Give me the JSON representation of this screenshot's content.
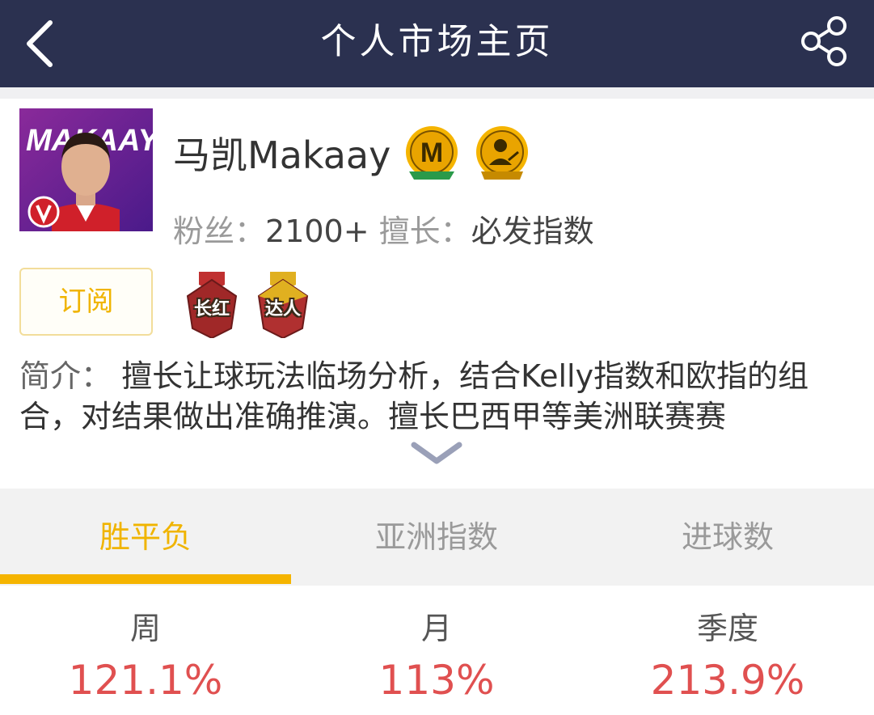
{
  "header": {
    "title": "个人市场主页",
    "back_icon": "back-arrow-icon",
    "share_icon": "share-icon"
  },
  "profile": {
    "name": "马凯Makaay",
    "avatar_text": "MAKAAY",
    "fans_label": "粉丝：",
    "fans_value": "2100+",
    "expertise_label": "擅长：",
    "expertise_value": "必发指数",
    "subscribe_label": "订阅",
    "medals": [
      {
        "label": "长红",
        "color": "#b03030"
      },
      {
        "label": "达人",
        "color": "#c08a10"
      }
    ]
  },
  "intro": {
    "label": "简介：",
    "text": " 擅长让球玩法临场分析，结合Kelly指数和欧指的组合，对结果做出准确推演。擅长巴西甲等美洲联赛赛"
  },
  "tabs": [
    {
      "label": "胜平负",
      "active": true
    },
    {
      "label": "亚洲指数",
      "active": false
    },
    {
      "label": "进球数",
      "active": false
    }
  ],
  "stats": [
    {
      "period": "周",
      "value": "121.1%"
    },
    {
      "period": "月",
      "value": "113%"
    },
    {
      "period": "季度",
      "value": "213.9%"
    }
  ],
  "colors": {
    "nav_bg": "#2b3150",
    "accent": "#f5b400",
    "value_red": "#e05050"
  }
}
